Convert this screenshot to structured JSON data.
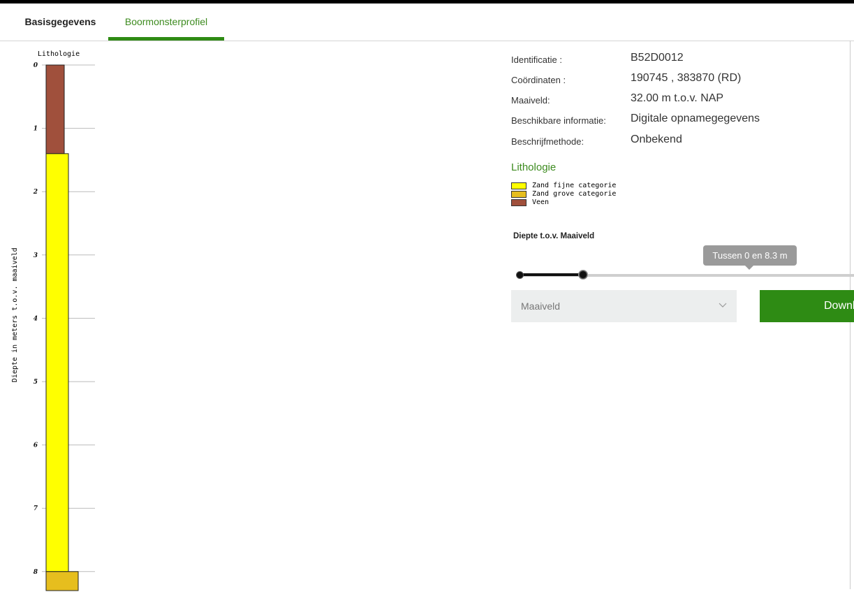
{
  "tabs": [
    {
      "label": "Basisgegevens",
      "active": false
    },
    {
      "label": "Boormonsterprofiel",
      "active": true
    }
  ],
  "chart_data": {
    "type": "lithology-column",
    "title": "Lithologie",
    "ylabel": "Diepte in meters t.o.v. maaiveld",
    "ylim": [
      0,
      8.3
    ],
    "yticks": [
      0,
      1,
      2,
      3,
      4,
      5,
      6,
      7,
      8
    ],
    "layers": [
      {
        "from": 0,
        "to": 1.4,
        "type": "Veen",
        "color": "#a0503c"
      },
      {
        "from": 1.4,
        "to": 8.0,
        "type": "Zand fijne categorie",
        "color": "#ffff00"
      },
      {
        "from": 8.0,
        "to": 8.3,
        "type": "Zand grove categorie",
        "color": "#e6be1e"
      }
    ]
  },
  "info": {
    "identificatie": {
      "label": "Identificatie :",
      "value": "B52D0012"
    },
    "coordinaten": {
      "label": "Coördinaten :",
      "value": "190745 , 383870 (RD)"
    },
    "maaiveld": {
      "label": "Maaiveld:",
      "value": "32.00 m t.o.v. NAP"
    },
    "beschikbaar": {
      "label": "Beschikbare informatie:",
      "value": "Digitale opnamegegevens"
    },
    "methode": {
      "label": "Beschrijfmethode:",
      "value": "Onbekend"
    }
  },
  "legend": {
    "title": "Lithologie",
    "items": [
      {
        "label": "Zand fijne categorie",
        "color": "#ffff00"
      },
      {
        "label": "Zand grove categorie",
        "color": "#e6be1e"
      },
      {
        "label": "Veen",
        "color": "#a0503c"
      }
    ]
  },
  "depth_filter": {
    "label": "Diepte t.o.v. Maaiveld",
    "tooltip": "Tussen 0 en 8.3 m",
    "select_value": "Maaiveld",
    "download_label": "Download"
  }
}
